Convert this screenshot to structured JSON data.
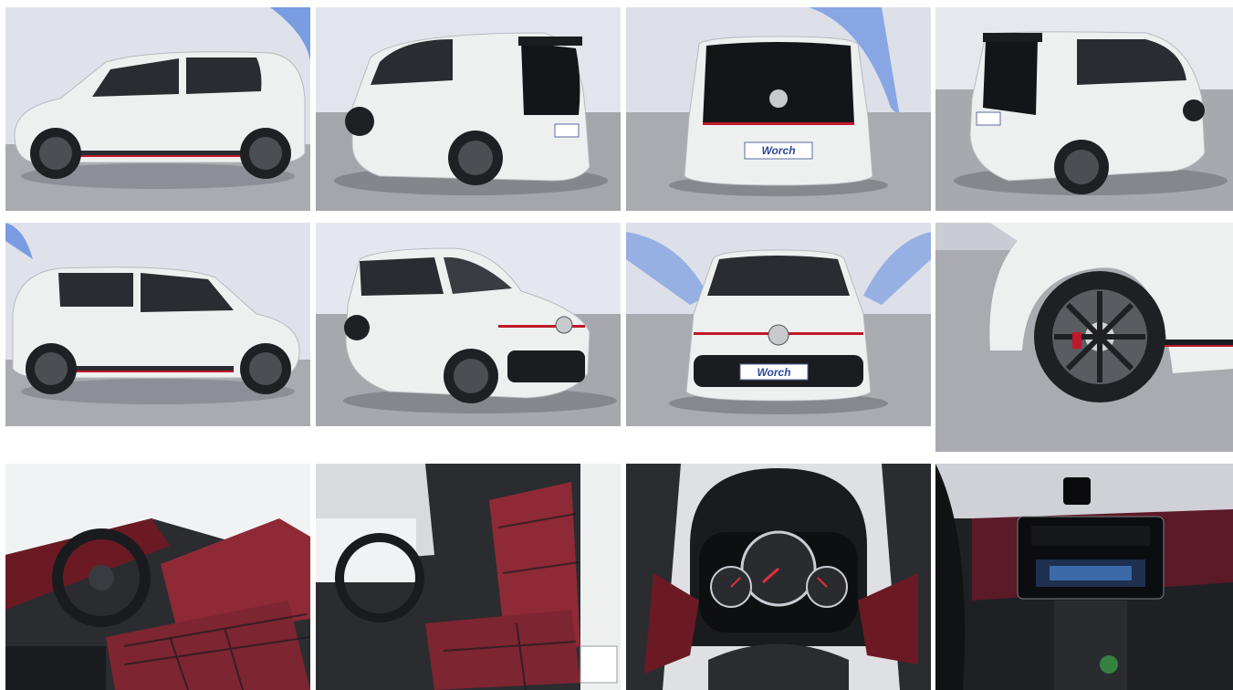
{
  "gallery": {
    "dealer_plate": "Worch",
    "colors": {
      "car_body": "#eef0f0",
      "studio_floor": "#a9abb1",
      "studio_wall": "#dfe2ea",
      "accent_led": "#4f7fe0",
      "gti_red": "#c0182a",
      "tartan_red": "#8e2a35"
    },
    "photos": [
      {
        "view": "side-left-exterior"
      },
      {
        "view": "rear-three-quarter-left"
      },
      {
        "view": "rear"
      },
      {
        "view": "rear-three-quarter-right"
      },
      {
        "view": "side-right-exterior"
      },
      {
        "view": "front-three-quarter-right"
      },
      {
        "view": "front"
      },
      {
        "view": "wheel-detail"
      },
      {
        "view": "interior-driver-seat"
      },
      {
        "view": "interior-seat-side"
      },
      {
        "view": "instrument-cluster"
      },
      {
        "view": "center-console"
      }
    ]
  }
}
